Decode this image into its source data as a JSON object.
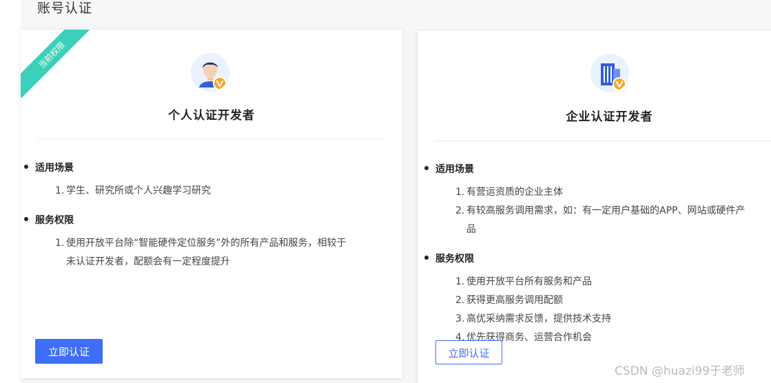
{
  "page": {
    "title": "账号认证"
  },
  "personal": {
    "ribbon": "当前权限",
    "avatar_icon": "developer-person-icon",
    "title": "个人认证开发者",
    "scenario_heading": "适用场景",
    "scenario_items": [
      {
        "num": "1.",
        "text": "学生、研究所或个人兴趣学习研究"
      }
    ],
    "rights_heading": "服务权限",
    "rights_items": [
      {
        "num": "1.",
        "line1": "使用开放平台除“智能硬件定位服务”外的所有产品和服务，相较于",
        "line2": "未认证开发者，配额会有一定程度提升"
      }
    ],
    "button_label": "立即认证"
  },
  "enterprise": {
    "avatar_icon": "enterprise-building-icon",
    "title": "企业认证开发者",
    "scenario_heading": "适用场景",
    "scenario_items": [
      {
        "num": "1.",
        "text": "有营运资质的企业主体"
      },
      {
        "num": "2.",
        "line1": "有较高服务调用需求，如：有一定用户基础的APP、网站或硬件产",
        "line2": "品"
      }
    ],
    "rights_heading": "服务权限",
    "rights_items": [
      {
        "num": "1.",
        "text": "使用开放平台所有服务和产品"
      },
      {
        "num": "2.",
        "text": "获得更高服务调用配额"
      },
      {
        "num": "3.",
        "text": "高优采纳需求反馈，提供技术支持"
      },
      {
        "num": "4.",
        "text": "优先获得商务、运营合作机会"
      }
    ],
    "button_label": "立即认证"
  },
  "watermark": "CSDN @huazi99于老师",
  "colors": {
    "ribbon": "#3ccfb9",
    "primary": "#3d6ef5",
    "verified_badge": "#f5a623"
  }
}
